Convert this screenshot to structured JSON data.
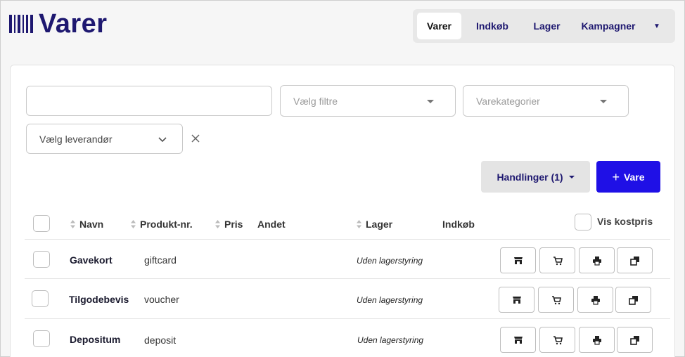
{
  "app": {
    "title": "Varer"
  },
  "nav": {
    "tabs": [
      {
        "label": "Varer",
        "active": true
      },
      {
        "label": "Indkøb",
        "active": false
      },
      {
        "label": "Lager",
        "active": false
      },
      {
        "label": "Kampagner",
        "active": false
      }
    ],
    "more_icon": "caret-down-icon"
  },
  "filters": {
    "search": {
      "value": "",
      "placeholder": ""
    },
    "filter_select": {
      "placeholder": "Vælg filtre"
    },
    "category_select": {
      "placeholder": "Varekategorier"
    },
    "supplier_select": {
      "value": "Vælg leverandør"
    }
  },
  "toolbar": {
    "actions_label": "Handlinger (1)",
    "add_label": "Vare",
    "add_icon": "plus-icon"
  },
  "table": {
    "headers": {
      "name": "Navn",
      "product_no": "Produkt-nr.",
      "price": "Pris",
      "other": "Andet",
      "stock": "Lager",
      "purchase": "Indkøb",
      "show_cost": "Vis kostpris"
    },
    "rows": [
      {
        "name": "Gavekort",
        "product_no": "giftcard",
        "stock": "Uden lagerstyring"
      },
      {
        "name": "Tilgodebevis",
        "product_no": "voucher",
        "stock": "Uden lagerstyring"
      },
      {
        "name": "Depositum",
        "product_no": "deposit",
        "stock": "Uden lagerstyring"
      }
    ],
    "row_action_icons": [
      "store-icon",
      "cart-icon",
      "printer-icon",
      "copy-icon"
    ]
  },
  "colors": {
    "brand": "#1e1870",
    "primary": "#1f10e6",
    "neutral_button": "#e4e4e4"
  }
}
